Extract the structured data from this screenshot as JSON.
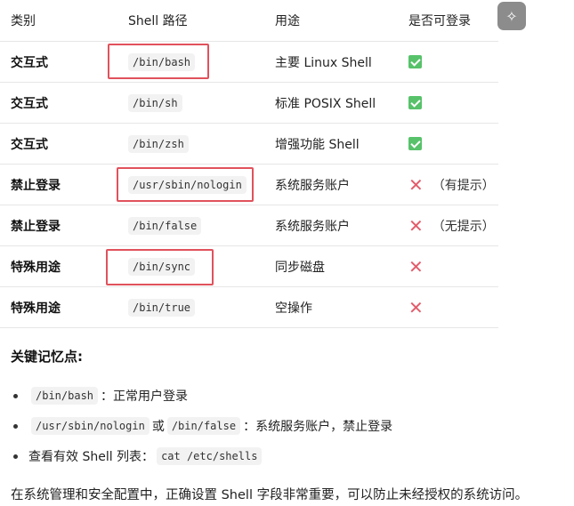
{
  "table": {
    "headers": [
      "类别",
      "Shell 路径",
      "用途",
      "是否可登录"
    ],
    "rows": [
      {
        "category": "交互式",
        "path": "/bin/bash",
        "use": "主要 Linux Shell",
        "login": "yes",
        "note": ""
      },
      {
        "category": "交互式",
        "path": "/bin/sh",
        "use": "标准 POSIX Shell",
        "login": "yes",
        "note": ""
      },
      {
        "category": "交互式",
        "path": "/bin/zsh",
        "use": "增强功能 Shell",
        "login": "yes",
        "note": ""
      },
      {
        "category": "禁止登录",
        "path": "/usr/sbin/nologin",
        "use": "系统服务账户",
        "login": "no",
        "note": "（有提示）"
      },
      {
        "category": "禁止登录",
        "path": "/bin/false",
        "use": "系统服务账户",
        "login": "no",
        "note": "（无提示）"
      },
      {
        "category": "特殊用途",
        "path": "/bin/sync",
        "use": "同步磁盘",
        "login": "no",
        "note": ""
      },
      {
        "category": "特殊用途",
        "path": "/bin/true",
        "use": "空操作",
        "login": "no",
        "note": ""
      }
    ]
  },
  "key_points": {
    "title": "关键记忆点:",
    "items": [
      {
        "code1": "/bin/bash",
        "text1": "：正常用户登录",
        "code2": "",
        "text2": ""
      },
      {
        "code1": "/usr/sbin/nologin",
        "text1": "或",
        "code2": "/bin/false",
        "text2": "：系统服务账户，禁止登录"
      },
      {
        "prefix": "查看有效 Shell 列表：",
        "code1": "cat /etc/shells"
      }
    ]
  },
  "footer": "在系统管理和安全配置中，正确设置 Shell 字段非常重要，可以防止未经授权的系统访问。",
  "colors": {
    "check": "#57c26a",
    "cross": "#e25c6b",
    "highlight": "#e0525c"
  },
  "icons": {
    "check": "check-icon",
    "cross": "cross-icon",
    "magic": "magic-wand-icon"
  }
}
